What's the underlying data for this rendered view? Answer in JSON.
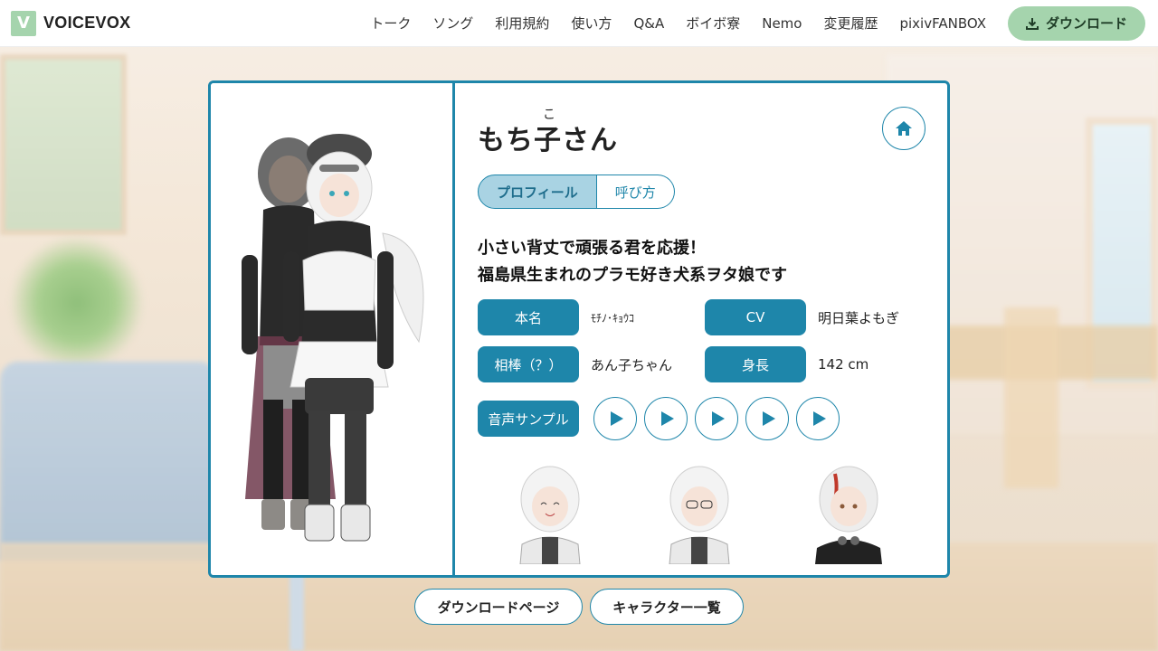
{
  "header": {
    "logo_mark": "V",
    "logo_text": "VOICEVOX",
    "nav": [
      "トーク",
      "ソング",
      "利用規約",
      "使い方",
      "Q&A",
      "ボイボ寮",
      "Nemo",
      "変更履歴",
      "pixivFANBOX"
    ],
    "download_label": "ダウンロード",
    "download_icon": "download-icon"
  },
  "character": {
    "name": "もち子さん",
    "ruby": "こ",
    "tabs": [
      "プロフィール",
      "呼び方"
    ],
    "active_tab": "プロフィール",
    "catch_line1": "小さい背丈で頑張る君を応援！",
    "catch_line2": "福島県生まれのプラモ好き犬系ヲタ娘です",
    "info": {
      "real_name_label": "本名",
      "real_name_value": "ﾓﾁﾉ･ｷｮｳｺ",
      "cv_label": "CV",
      "cv_value": "明日葉よもぎ",
      "partner_label": "相棒（？）",
      "partner_value": "あん子ちゃん",
      "height_label": "身長",
      "height_value": "142 cm"
    },
    "voice_sample_label": "音声サンプル",
    "voice_sample_count": 5
  },
  "bottom": {
    "download_page": "ダウンロードページ",
    "character_list": "キャラクター一覧"
  },
  "colors": {
    "accent": "#1e86aa",
    "accent_light": "#a9d3e3",
    "brand_green": "#a5d4ad"
  }
}
